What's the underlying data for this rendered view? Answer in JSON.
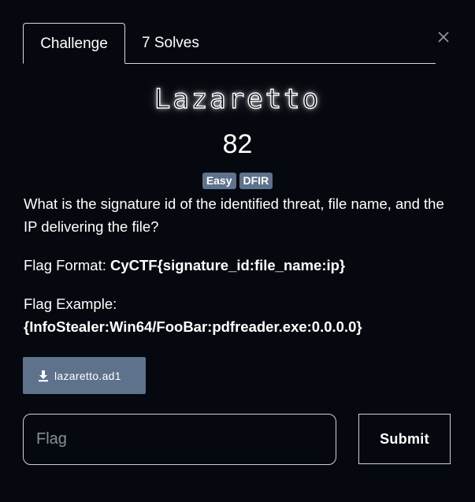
{
  "tabs": {
    "challenge_label": "Challenge",
    "solves_label": "7 Solves"
  },
  "challenge": {
    "name": "Lazaretto",
    "points": "82",
    "tags": [
      "Easy",
      "DFIR"
    ],
    "description": "What is the signature id of the identified threat, file name, and the IP delivering the file?",
    "format_label": "Flag Format: ",
    "format_value": "CyCTF{signature_id:file_name:ip}",
    "example_label": "Flag Example:",
    "example_value": "{InfoStealer:Win64/FooBar:pdfreader.exe:0.0.0.0}"
  },
  "file": {
    "name": "lazaretto.ad1",
    "icon": "download-icon"
  },
  "submission": {
    "placeholder": "Flag",
    "value": "",
    "submit_label": "Submit"
  },
  "icons": {
    "close": "close-icon"
  },
  "colors": {
    "background": "#05090f",
    "tag": "#5e728c",
    "button": "#5e728c",
    "border": "#d8d8d8"
  }
}
